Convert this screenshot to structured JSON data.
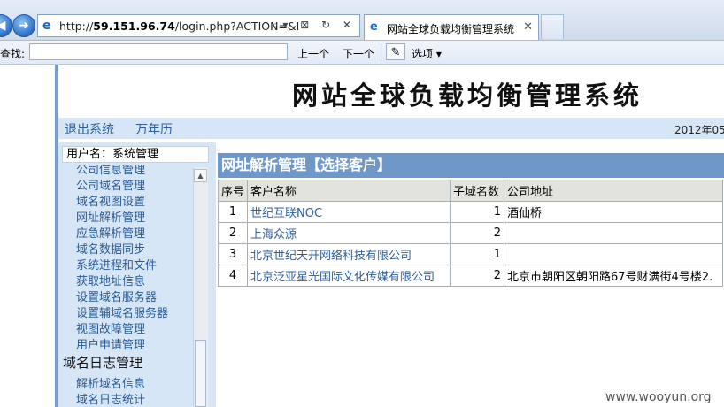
{
  "browser": {
    "url_prefix": "http://",
    "url_host": "59.151.96.74",
    "url_path": "/login.php?ACTION=&LC",
    "tab_title": "网站全球负载均衡管理系统",
    "address_tools": "⌕▾ ⊠ ↻ ✕",
    "tab_close": "✕"
  },
  "findbar": {
    "label": "查找:",
    "prev": "上一个",
    "next": "下一个",
    "options": "选项 ▾"
  },
  "header": {
    "title": "网站全球负载均衡管理系统",
    "logout": "退出系统",
    "calendar": "万年历",
    "date": "2012年05"
  },
  "sidebar": {
    "user": "用户名：系统管理",
    "items": [
      {
        "label": "公司信息管理",
        "kind": "item"
      },
      {
        "label": "公司域名管理",
        "kind": "item"
      },
      {
        "label": "域名视图设置",
        "kind": "item"
      },
      {
        "label": "网址解析管理",
        "kind": "item"
      },
      {
        "label": "应急解析管理",
        "kind": "item"
      },
      {
        "label": "域名数据同步",
        "kind": "item"
      },
      {
        "label": "系统进程和文件",
        "kind": "item"
      },
      {
        "label": "获取地址信息",
        "kind": "item"
      },
      {
        "label": "设置域名服务器",
        "kind": "item"
      },
      {
        "label": "设置辅域名服务器",
        "kind": "item"
      },
      {
        "label": "视图故障管理",
        "kind": "item"
      },
      {
        "label": "用户申请管理",
        "kind": "item"
      },
      {
        "label": "域名日志管理",
        "kind": "group"
      },
      {
        "label": "解析域名信息",
        "kind": "item"
      },
      {
        "label": "域名日志统计",
        "kind": "item"
      }
    ]
  },
  "main": {
    "panel_title": "网址解析管理【选择客户】",
    "columns": [
      "序号",
      "客户名称",
      "子域名数",
      "公司地址"
    ],
    "rows": [
      {
        "no": "1",
        "name": "世纪互联NOC",
        "count": "1",
        "address": "酒仙桥"
      },
      {
        "no": "2",
        "name": "上海众源",
        "count": "2",
        "address": ""
      },
      {
        "no": "3",
        "name": "北京世纪天开网络科技有限公司",
        "count": "1",
        "address": ""
      },
      {
        "no": "4",
        "name": "北京泛亚星光国际文化传媒有限公司",
        "count": "2",
        "address": "北京市朝阳区朝阳路67号财满街4号楼2."
      }
    ]
  },
  "watermark": "www.wooyun.org"
}
